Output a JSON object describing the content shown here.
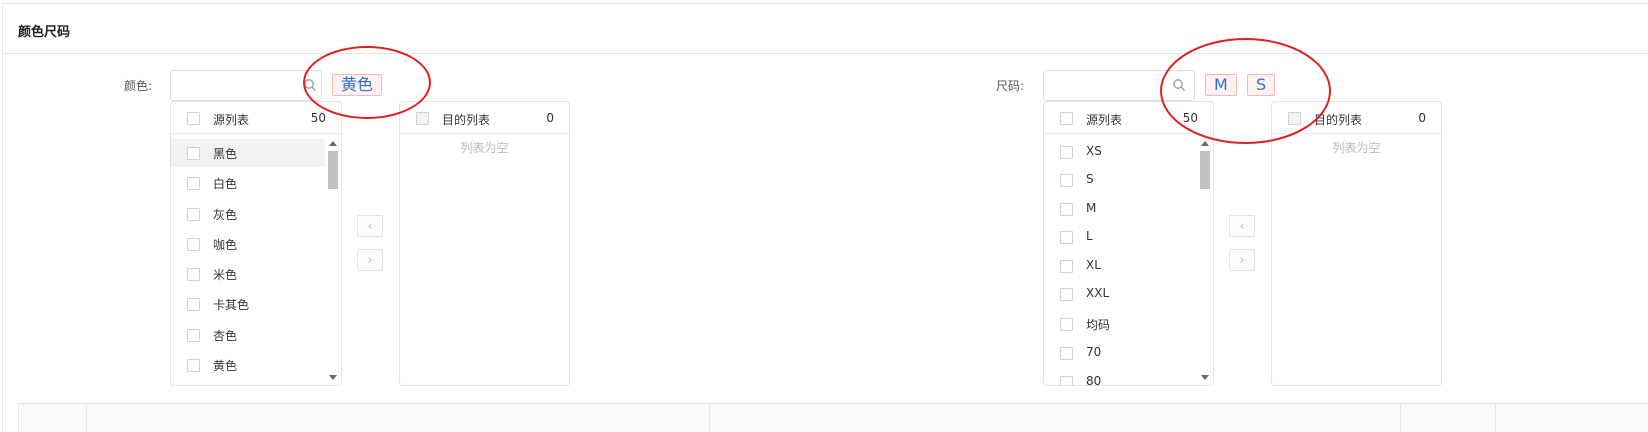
{
  "section": {
    "title": "颜色尺码"
  },
  "color": {
    "label": "颜色:",
    "search_value": "",
    "selected_tags": [
      "黄色"
    ],
    "source": {
      "title": "源列表",
      "count": "50",
      "items": [
        "黑色",
        "白色",
        "灰色",
        "咖色",
        "米色",
        "卡其色",
        "杏色",
        "黄色"
      ]
    },
    "target": {
      "title": "目的列表",
      "count": "0",
      "empty_text": "列表为空"
    },
    "move_left_label": "‹",
    "move_right_label": "›"
  },
  "size": {
    "label": "尺码:",
    "search_value": "",
    "selected_tags": [
      "M",
      "S"
    ],
    "source": {
      "title": "源列表",
      "count": "50",
      "items": [
        "XS",
        "S",
        "M",
        "L",
        "XL",
        "XXL",
        "均码",
        "70",
        "80"
      ]
    },
    "target": {
      "title": "目的列表",
      "count": "0",
      "empty_text": "列表为空"
    },
    "move_left_label": "‹",
    "move_right_label": "›"
  },
  "colors": {
    "annotation": "#e02020",
    "tag_text": "#2f6fd0",
    "tag_border": "#f5b8b8"
  }
}
